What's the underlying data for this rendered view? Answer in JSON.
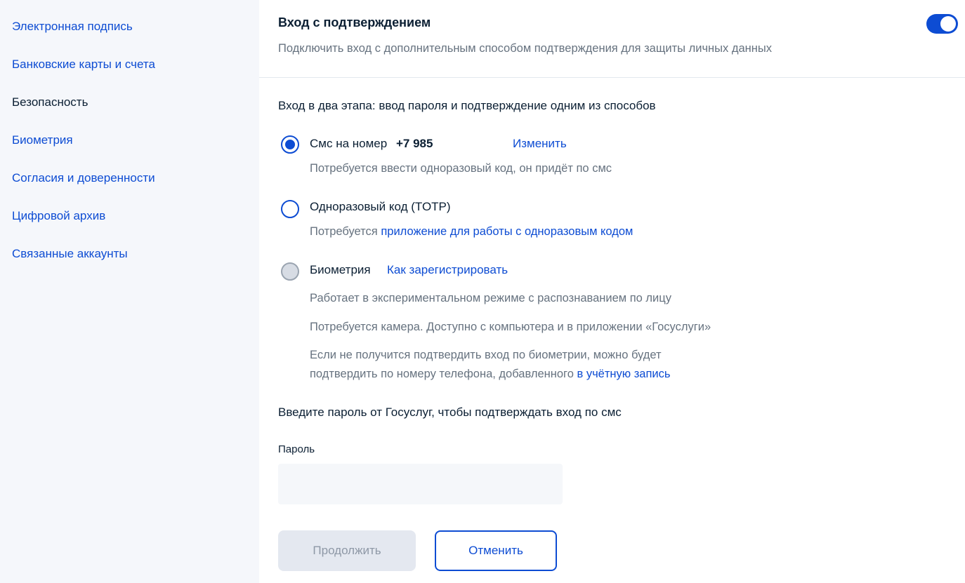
{
  "sidebar": {
    "items": [
      {
        "label": "Электронная подпись"
      },
      {
        "label": "Банковские карты и счета"
      },
      {
        "label": "Безопасность"
      },
      {
        "label": "Биометрия"
      },
      {
        "label": "Согласия и доверенности"
      },
      {
        "label": "Цифровой архив"
      },
      {
        "label": "Связанные аккаунты"
      }
    ],
    "active_item": "Безопасность"
  },
  "login_confirmation": {
    "title": "Вход с подтверждением",
    "subtitle": "Подключить вход с дополнительным способом подтверждения для защиты личных данных",
    "toggle_state": "on",
    "lead": "Вход в два этапа: ввод пароля и подтверждение одним из способов",
    "options": {
      "sms": {
        "label": "Смс на номер",
        "phone": "+7 985",
        "change_link": "Изменить",
        "hint": "Потребуется ввести одноразовый код, он придёт по смс",
        "state": "selected"
      },
      "totp": {
        "label": "Одноразовый код (TOTP)",
        "hint_prefix": "Потребуется ",
        "hint_link": "приложение для работы с одноразовым кодом",
        "state": "unselected"
      },
      "biometry": {
        "label": "Биометрия",
        "register_link": "Как зарегистрировать",
        "hint1": "Работает в экспериментальном режиме с распознаванием по лицу",
        "hint2": "Потребуется камера. Доступно с компьютера и в приложении «Госуслуги»",
        "hint3_line1": "Если не получится подтвердить вход по биометрии, можно будет",
        "hint3_line2_prefix": "подтвердить по номеру телефона, добавленного ",
        "hint3_link": "в учётную запись",
        "state": "disabled"
      }
    },
    "password_prompt": "Введите пароль от Госуслуг, чтобы подтверждать вход по смс",
    "password_label": "Пароль",
    "password_value": "",
    "continue_button": "Продолжить",
    "cancel_button": "Отменить"
  },
  "colors": {
    "accent": "#0d4cd3",
    "text_primary": "#0b1f33",
    "text_secondary": "#66727f",
    "sidebar_bg": "#f5f7fb",
    "disabled_button_bg": "#e4e8f0"
  },
  "icons": {
    "toggle": "toggle-switch-on",
    "sms_radio": "radio-checked",
    "totp_radio": "radio-unchecked",
    "biometry_radio": "radio-disabled"
  }
}
